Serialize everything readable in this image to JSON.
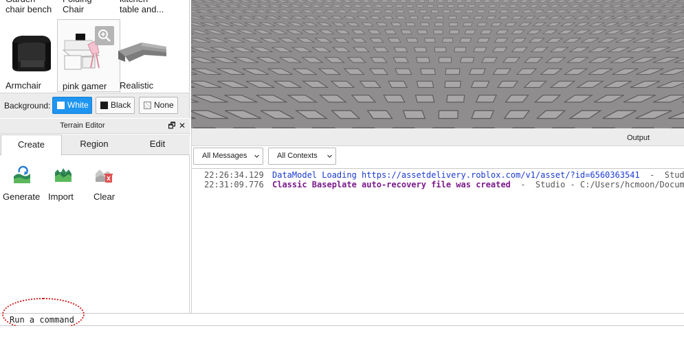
{
  "toolbox": {
    "top_items": [
      "Garden\nchair bench",
      "Folding\nChair",
      "kitchen\ntable and..."
    ],
    "items": [
      {
        "label": "Armchair"
      },
      {
        "label": "pink gamer"
      },
      {
        "label": "Realistic"
      }
    ]
  },
  "background_bar": {
    "label": "Background:",
    "options": [
      "White",
      "Black",
      "None"
    ],
    "selected": "White",
    "selected_color": "#1e95f0"
  },
  "terrain_editor": {
    "title": "Terrain Editor",
    "tabs": [
      "Create",
      "Region",
      "Edit"
    ],
    "active_tab": "Create",
    "tools": [
      {
        "label": "Generate",
        "icon": "generate-icon"
      },
      {
        "label": "Import",
        "icon": "import-icon"
      },
      {
        "label": "Clear",
        "icon": "clear-icon"
      }
    ]
  },
  "output": {
    "title": "Output",
    "filters": {
      "messages": "All Messages",
      "contexts": "All Contexts"
    },
    "log": [
      {
        "time": "22:26:34.129",
        "message": "DataModel Loading https://assetdelivery.roblox.com/v1/asset/?id=6560363541",
        "separator": "  -  ",
        "source": "Studio",
        "color": "#1a3acf"
      },
      {
        "time": "22:31:09.776",
        "message": "Classic Baseplate auto-recovery file was created",
        "separator": "  -  ",
        "source": "Studio - C:/Users/hcmoon/Documents",
        "color": "#7a1a8a"
      }
    ]
  },
  "command_bar": {
    "placeholder": "Run a command",
    "highlight_color": "#d01818"
  }
}
